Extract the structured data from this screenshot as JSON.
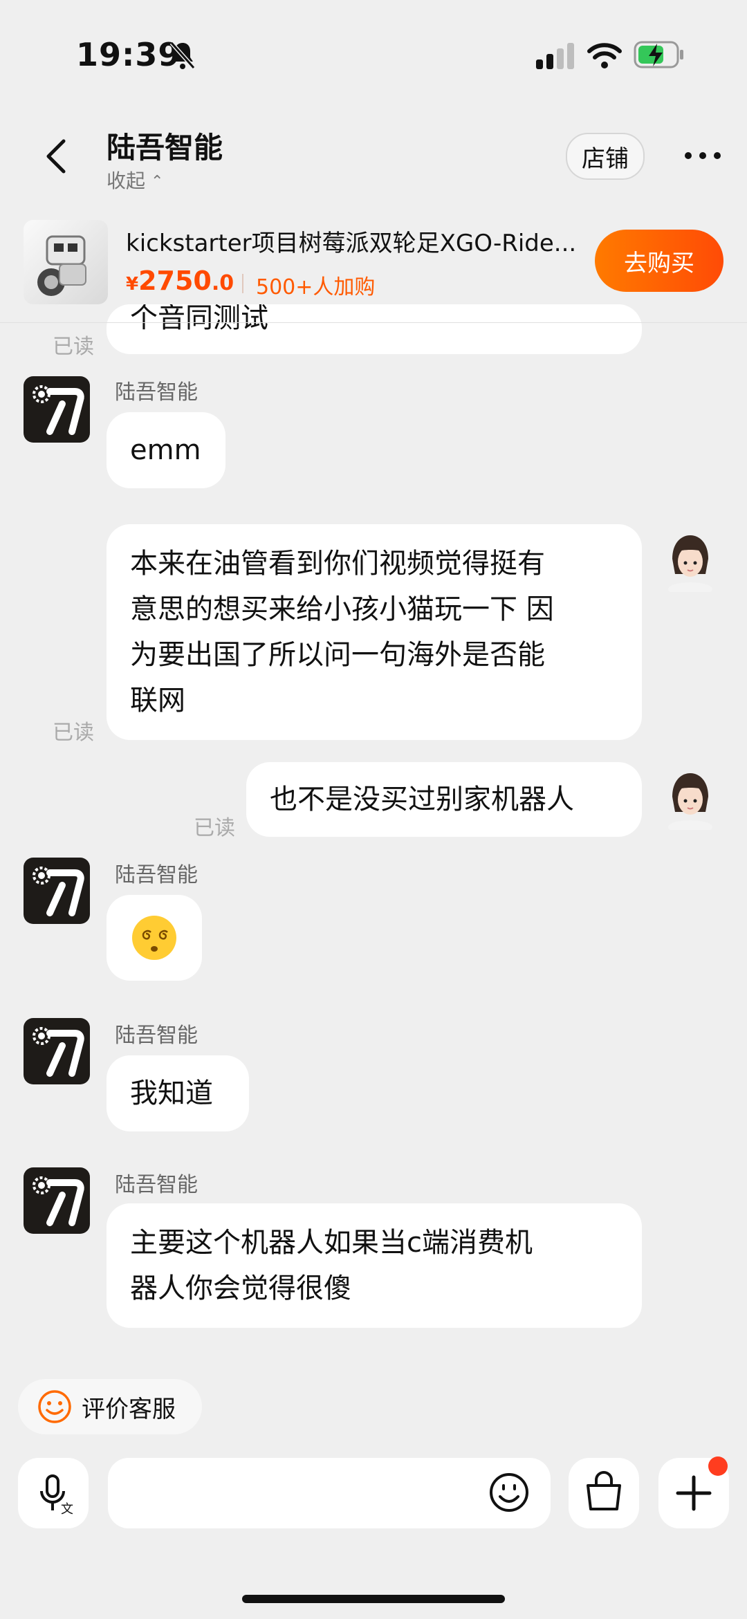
{
  "status_bar": {
    "time": "19:39"
  },
  "header": {
    "title": "陆吾智能",
    "collapse_label": "收起",
    "store_label": "店铺"
  },
  "product": {
    "name": "kickstarter项目树莓派双轮足XGO-Ride...",
    "price_symbol": "¥",
    "price_int": "2750",
    "price_dec": ".0",
    "sales": "500+人加购",
    "buy_label": "去购买"
  },
  "chat": {
    "read_label": "已读",
    "partial_text": "个音同测试",
    "messages": [
      {
        "from": "merchant",
        "sender": "陆吾智能",
        "text": "emm"
      },
      {
        "from": "user",
        "lines": [
          "本来在油管看到你们视频觉得挺有",
          "意思的想买来给小孩小猫玩一下 因",
          "为要出国了所以问一句海外是否能",
          "联网"
        ]
      },
      {
        "from": "user",
        "text": "也不是没买过别家机器人"
      },
      {
        "from": "merchant",
        "sender": "陆吾智能",
        "text": "😵‍💫"
      },
      {
        "from": "merchant",
        "sender": "陆吾智能",
        "text": "我知道"
      },
      {
        "from": "merchant",
        "sender": "陆吾智能",
        "lines": [
          "主要这个机器人如果当c端消费机",
          "器人你会觉得很傻"
        ]
      }
    ]
  },
  "footer": {
    "rate_label": "评价客服",
    "icons": [
      "voice-icon",
      "emoji-icon",
      "bag-icon",
      "plus-icon"
    ]
  },
  "colors": {
    "accent": "#ff4a00",
    "background": "#efefef",
    "bubble": "#ffffff"
  }
}
